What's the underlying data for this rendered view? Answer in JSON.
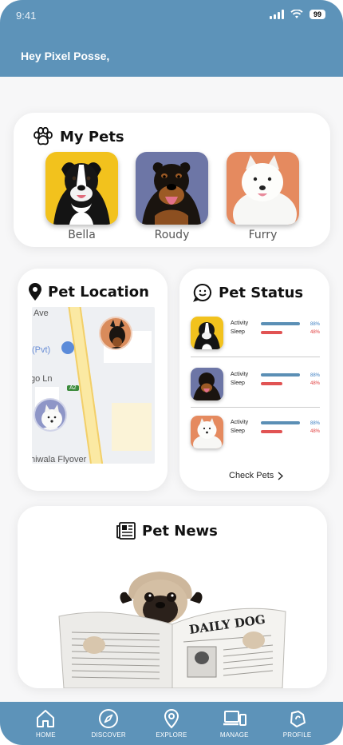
{
  "status_bar": {
    "time": "9:41",
    "battery": "99"
  },
  "header": {
    "greeting": "Hey Pixel Posse,"
  },
  "my_pets": {
    "title": "My Pets",
    "icon": "paw-icon",
    "pets": [
      {
        "name": "Bella",
        "bg": "#f2c21d"
      },
      {
        "name": "Roudy",
        "bg": "#6d76a6"
      },
      {
        "name": "Furry",
        "bg": "#e58a5f"
      }
    ]
  },
  "pet_location": {
    "title": "Pet Location",
    "icon": "location-pin-icon",
    "map_labels": {
      "ave": "Ave",
      "pvt": "(Pvt)",
      "go_ln": "go Ln",
      "road_badge": "A2",
      "flyover": "hiwala Flyover"
    }
  },
  "pet_status": {
    "title": "Pet Status",
    "icon": "chat-face-icon",
    "rows": [
      {
        "activity_label": "Activity",
        "sleep_label": "Sleep",
        "activity": "88%",
        "sleep": "48%"
      },
      {
        "activity_label": "Activity",
        "sleep_label": "Sleep",
        "activity": "88%",
        "sleep": "48%"
      },
      {
        "activity_label": "Activity",
        "sleep_label": "Sleep",
        "activity": "88%",
        "sleep": "48%"
      }
    ],
    "activity_value": 0.88,
    "sleep_value": 0.48,
    "link": "Check Pets"
  },
  "pet_news": {
    "title": "Pet News",
    "icon": "newspaper-icon",
    "newspaper_title": "DAILY DOG"
  },
  "nav": [
    {
      "label": "HOME",
      "icon": "home-icon"
    },
    {
      "label": "DISCOVER",
      "icon": "compass-icon"
    },
    {
      "label": "EXPLORE",
      "icon": "map-pin-icon"
    },
    {
      "label": "MANAGE",
      "icon": "devices-icon"
    },
    {
      "label": "PROFILE",
      "icon": "profile-tag-icon"
    }
  ],
  "colors": {
    "primary": "#5d93b9",
    "activity_bar": "#5b8fb5",
    "sleep_bar": "#e15353",
    "activity_text": "#3d7fc1",
    "sleep_text": "#e03c3c"
  }
}
